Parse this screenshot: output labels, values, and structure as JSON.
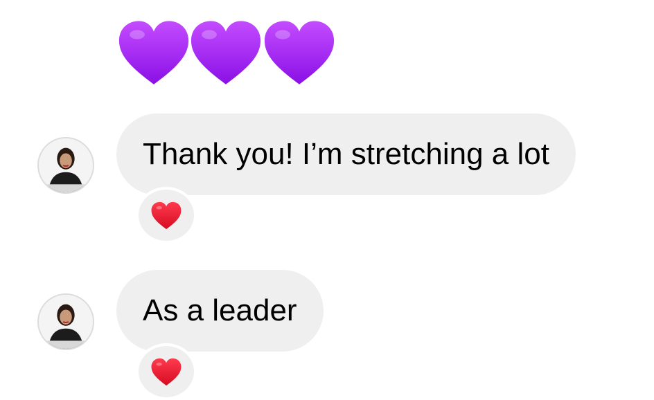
{
  "top_reaction": {
    "icon": "purple-heart-icon",
    "count": 3,
    "color": "#a020f0"
  },
  "messages": [
    {
      "text": "Thank you! I’m stretching a lot",
      "reaction_icon": "red-heart-icon"
    },
    {
      "text": "As a leader",
      "reaction_icon": "red-heart-icon"
    }
  ],
  "colors": {
    "bubble_bg": "#efefef",
    "reaction_heart": "#e8112d",
    "purple_heart": "#a020f0"
  }
}
